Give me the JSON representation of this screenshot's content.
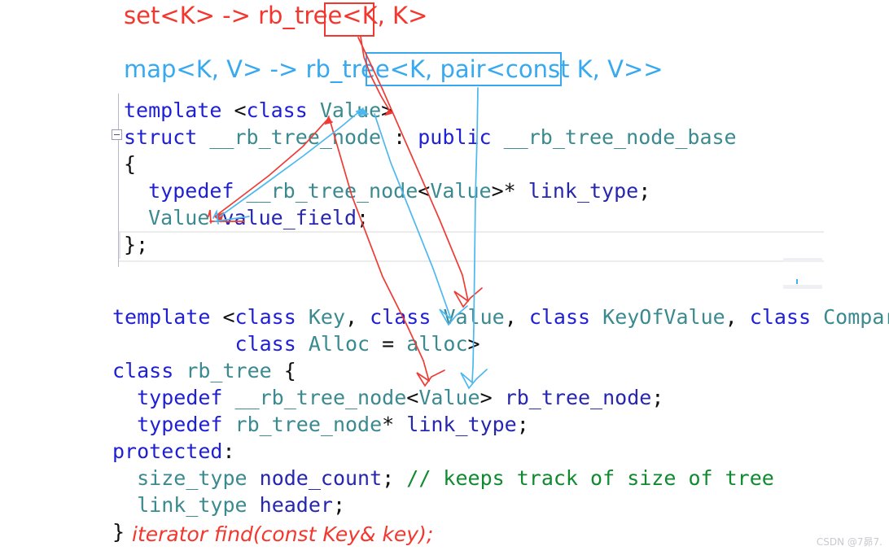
{
  "annotations": {
    "set_line": "set<K> -> rb_tree<K, K>",
    "map_line": "map<K, V> -> rb_tree<K, pair<const K, V>>",
    "find_line": "iterator find(const Key& key);",
    "set_color": "#f4372e",
    "map_color": "#36a9f0",
    "box_set_label": "K, K",
    "box_map_label": "K, pair<const K, V>"
  },
  "watermark": "CSDN @7昴7.",
  "editor": {
    "colors": {
      "keyword": "#1f1fd6",
      "type": "#3a8a8f",
      "identifier": "#2626b0",
      "plain": "#101010",
      "comment": "#0f8a2f"
    },
    "fold_marker": "-",
    "block1": [
      [
        {
          "t": "template ",
          "c": "kw"
        },
        {
          "t": "<",
          "c": "pl"
        },
        {
          "t": "class",
          "c": "kw"
        },
        {
          "t": " ",
          "c": "pl"
        },
        {
          "t": "Value",
          "c": "ty"
        },
        {
          "t": ">",
          "c": "pl"
        }
      ],
      [
        {
          "t": "struct",
          "c": "kw"
        },
        {
          "t": " ",
          "c": "pl"
        },
        {
          "t": "__rb_tree_node",
          "c": "ty"
        },
        {
          "t": " : ",
          "c": "pl"
        },
        {
          "t": "public",
          "c": "kw"
        },
        {
          "t": " ",
          "c": "pl"
        },
        {
          "t": "__rb_tree_node_base",
          "c": "ty"
        }
      ],
      [
        {
          "t": "{",
          "c": "pl"
        }
      ],
      [
        {
          "t": "  ",
          "c": "pl"
        },
        {
          "t": "typedef",
          "c": "kw"
        },
        {
          "t": " ",
          "c": "pl"
        },
        {
          "t": "__rb_tree_node",
          "c": "ty"
        },
        {
          "t": "<",
          "c": "pl"
        },
        {
          "t": "Value",
          "c": "ty"
        },
        {
          "t": ">* ",
          "c": "pl"
        },
        {
          "t": "link_type",
          "c": "id"
        },
        {
          "t": ";",
          "c": "pl"
        }
      ],
      [
        {
          "t": "  ",
          "c": "pl"
        },
        {
          "t": "Value",
          "c": "ty"
        },
        {
          "t": " ",
          "c": "pl"
        },
        {
          "t": "value_field",
          "c": "id"
        },
        {
          "t": ";",
          "c": "pl"
        }
      ],
      [
        {
          "t": "};",
          "c": "pl"
        }
      ]
    ],
    "block2": [
      [
        {
          "t": "template ",
          "c": "kw"
        },
        {
          "t": "<",
          "c": "pl"
        },
        {
          "t": "class",
          "c": "kw"
        },
        {
          "t": " ",
          "c": "pl"
        },
        {
          "t": "Key",
          "c": "ty"
        },
        {
          "t": ", ",
          "c": "pl"
        },
        {
          "t": "class",
          "c": "kw"
        },
        {
          "t": " ",
          "c": "pl"
        },
        {
          "t": "Value",
          "c": "ty"
        },
        {
          "t": ", ",
          "c": "pl"
        },
        {
          "t": "class",
          "c": "kw"
        },
        {
          "t": " ",
          "c": "pl"
        },
        {
          "t": "KeyOfValue",
          "c": "ty"
        },
        {
          "t": ", ",
          "c": "pl"
        },
        {
          "t": "class",
          "c": "kw"
        },
        {
          "t": " ",
          "c": "pl"
        },
        {
          "t": "Compare",
          "c": "ty"
        },
        {
          "t": ",",
          "c": "pl"
        }
      ],
      [
        {
          "t": "          ",
          "c": "pl"
        },
        {
          "t": "class",
          "c": "kw"
        },
        {
          "t": " ",
          "c": "pl"
        },
        {
          "t": "Alloc",
          "c": "ty"
        },
        {
          "t": " = ",
          "c": "pl"
        },
        {
          "t": "alloc",
          "c": "ty"
        },
        {
          "t": ">",
          "c": "pl"
        }
      ],
      [
        {
          "t": "class",
          "c": "kw"
        },
        {
          "t": " ",
          "c": "pl"
        },
        {
          "t": "rb_tree",
          "c": "ty"
        },
        {
          "t": " {",
          "c": "pl"
        }
      ],
      [
        {
          "t": "  ",
          "c": "pl"
        },
        {
          "t": "typedef",
          "c": "kw"
        },
        {
          "t": " ",
          "c": "pl"
        },
        {
          "t": "__rb_tree_node",
          "c": "ty"
        },
        {
          "t": "<",
          "c": "pl"
        },
        {
          "t": "Value",
          "c": "ty"
        },
        {
          "t": "> ",
          "c": "pl"
        },
        {
          "t": "rb_tree_node",
          "c": "id"
        },
        {
          "t": ";",
          "c": "pl"
        }
      ],
      [
        {
          "t": "  ",
          "c": "pl"
        },
        {
          "t": "typedef",
          "c": "kw"
        },
        {
          "t": " ",
          "c": "pl"
        },
        {
          "t": "rb_tree_node",
          "c": "ty"
        },
        {
          "t": "* ",
          "c": "pl"
        },
        {
          "t": "link_type",
          "c": "id"
        },
        {
          "t": ";",
          "c": "pl"
        }
      ],
      [
        {
          "t": "protected",
          "c": "kw"
        },
        {
          "t": ":",
          "c": "pl"
        }
      ],
      [
        {
          "t": "  ",
          "c": "pl"
        },
        {
          "t": "size_type",
          "c": "ty"
        },
        {
          "t": " ",
          "c": "pl"
        },
        {
          "t": "node_count",
          "c": "id"
        },
        {
          "t": "; ",
          "c": "pl"
        },
        {
          "t": "// keeps track of size of tree",
          "c": "cm"
        }
      ],
      [
        {
          "t": "  ",
          "c": "pl"
        },
        {
          "t": "link_type",
          "c": "ty"
        },
        {
          "t": " ",
          "c": "pl"
        },
        {
          "t": "header",
          "c": "id"
        },
        {
          "t": ";",
          "c": "pl"
        }
      ],
      [
        {
          "t": "}",
          "c": "pl"
        }
      ]
    ]
  }
}
